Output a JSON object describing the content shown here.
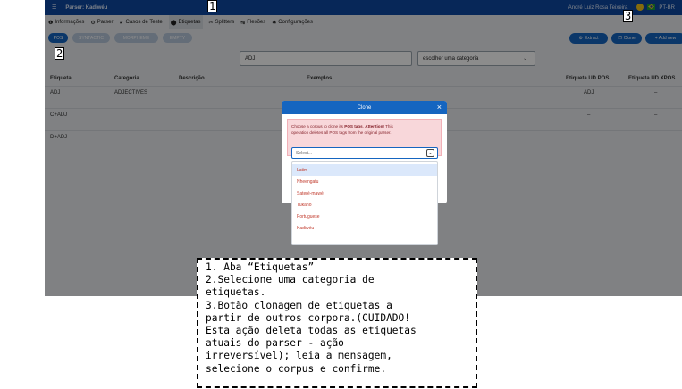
{
  "topbar": {
    "app_title": "Parser: Kadiwéu",
    "user": "André Luiz Rosa Teixeira",
    "lang": "PT-BR"
  },
  "menu": [
    {
      "icon": "❶",
      "label": "Informações"
    },
    {
      "icon": "⚙",
      "label": "Parser"
    },
    {
      "icon": "✔",
      "label": "Casos de Teste"
    },
    {
      "icon": "⬤",
      "label": "Etiquetas"
    },
    {
      "icon": "✂",
      "label": "Splitters"
    },
    {
      "icon": "↹",
      "label": "Flexões"
    },
    {
      "icon": "✱",
      "label": "Configurações"
    }
  ],
  "category_pills": [
    "POS",
    "SYNTACTIC",
    "MORPHEME",
    "EMPTY"
  ],
  "actions": {
    "extract": "Extract",
    "clone": "Clone",
    "add_new": "+ Add new"
  },
  "filter": {
    "value": "ADJ",
    "category_placeholder": "escolher uma categoria"
  },
  "table": {
    "columns": [
      "Etiqueta",
      "Categoria",
      "Descrição",
      "Exemplos",
      "Etiqueta UD POS",
      "Etiqueta UD XPOS"
    ],
    "rows": [
      {
        "tag": "ADJ",
        "category": "ADJECTIVES",
        "ud_pos": "ADJ",
        "ud_xpos": "–"
      },
      {
        "tag": "C+ADJ",
        "category": "",
        "ud_pos": "–",
        "ud_xpos": "–"
      },
      {
        "tag": "D+ADJ",
        "category": "",
        "ud_pos": "–",
        "ud_xpos": "–"
      }
    ]
  },
  "modal": {
    "title": "Clone",
    "alert_line1_a": "Choose a corpus to clone its ",
    "alert_line1_b": "POS tags",
    "alert_line1_c": ". ",
    "alert_line1_d": "Attention!",
    "alert_line1_e": " This",
    "alert_line2": "operation deletes all POS tags from the original parser.",
    "select_placeholder": "Select...",
    "options": [
      "Latim",
      "Nheengatu",
      "Sateré-mawé",
      "Tukano",
      "Portuguese",
      "Kadiwéu"
    ]
  },
  "markers": [
    "1",
    "2",
    "3"
  ],
  "note_lines": [
    "1. Aba “Etiquetas”",
    "2.Selecione uma categoria de",
    "etiquetas.",
    "3.Botão clonagem de etiquetas a",
    "partir de outros corpora.(CUIDADO!",
    "Esta ação deleta todas as etiquetas",
    "atuais do parser - ação",
    "irreversível); leia a mensagem,",
    "selecione o corpus e confirme."
  ]
}
